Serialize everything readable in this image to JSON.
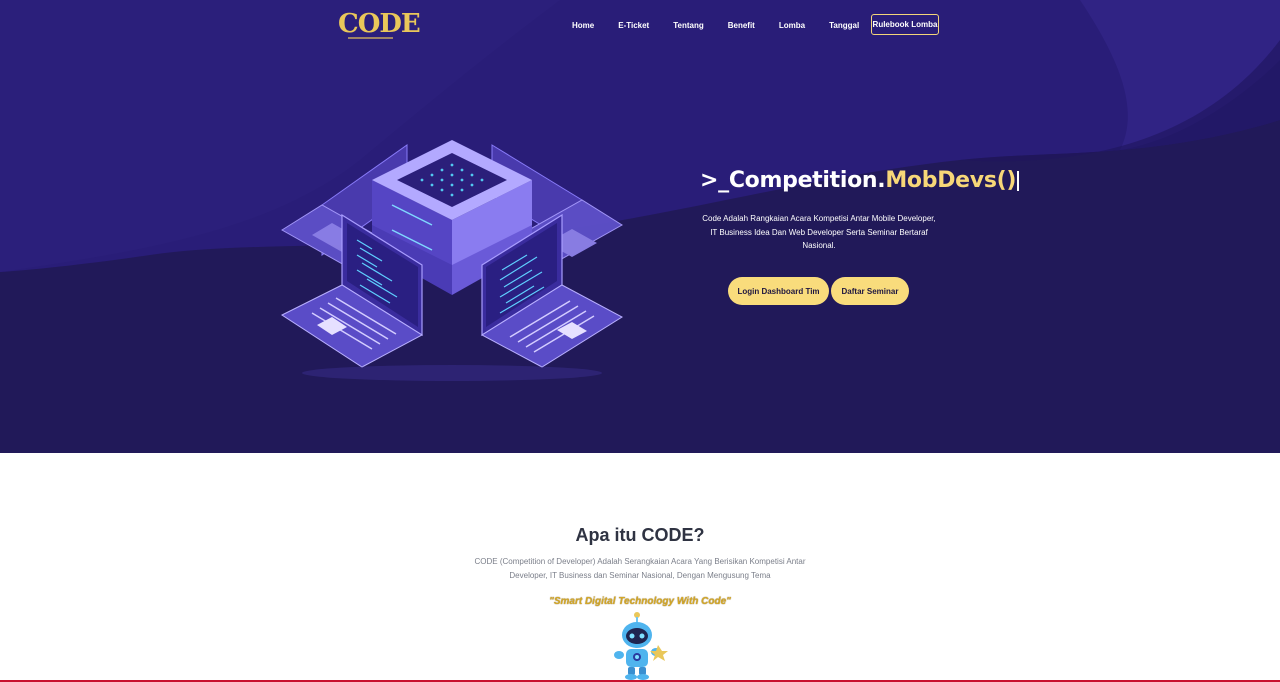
{
  "brand": {
    "logo_text": "CODE"
  },
  "nav": {
    "links": [
      "Home",
      "E-Ticket",
      "Tentang",
      "Benefit",
      "Lomba",
      "Tanggal"
    ],
    "cta": "Rulebook Lomba"
  },
  "hero": {
    "title_prefix": ">_Competition.",
    "title_accent": "MobDevs()",
    "description": "Code Adalah Rangkaian Acara Kompetisi Antar Mobile Developer, IT Business Idea Dan Web Developer Serta Seminar Bertaraf Nasional.",
    "buttons": {
      "login": "Login Dashboard Tim",
      "seminar": "Daftar Seminar"
    }
  },
  "about": {
    "title": "Apa itu CODE?",
    "description": "CODE (Competition of Developer) Adalah Serangkaian Acara Yang Berisikan Kompetisi Antar Developer, IT Business dan Seminar Nasional, Dengan Mengusung Tema",
    "tagline": "\"Smart Digital Technology With Code\""
  },
  "colors": {
    "hero_bg": "#241a5e",
    "accent_yellow": "#f9dc7c",
    "title_accent": "#f7d778"
  }
}
